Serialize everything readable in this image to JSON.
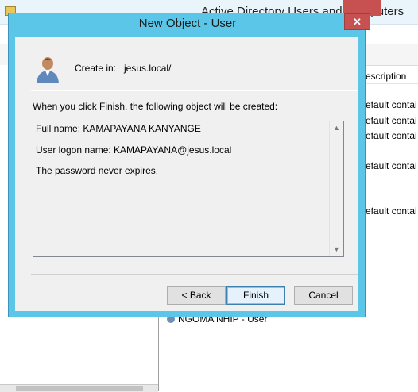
{
  "background_window": {
    "title": "Active Directory Users and Computers",
    "column_header": "Description",
    "column_header_visible": "escription",
    "rows": [
      "Default contai",
      "Default contai",
      "Default contai",
      "Default contai",
      "Default contai"
    ],
    "rows_visible": [
      "efault contai",
      "efault contai",
      "efault contai",
      "efault contai",
      "efault contai"
    ],
    "partial_user_row": "NGOMA NHIP - User"
  },
  "dialog": {
    "title": "New Object - User",
    "close_label": "✕",
    "create_in_label": "Create in:",
    "create_in_value": "jesus.local/",
    "info_text": "When you click Finish, the following object will be created:",
    "summary_lines": [
      "Full name: KAMAPAYANA KANYANGE",
      "User logon name: KAMAPAYANA@jesus.local",
      "The password never expires."
    ],
    "buttons": {
      "back": "< Back",
      "finish": "Finish",
      "cancel": "Cancel"
    }
  },
  "colors": {
    "titlebar": "#5bc6e8",
    "close_button": "#c75050",
    "client_bg": "#f0f0f0",
    "default_button_border": "#3c7fb1"
  }
}
